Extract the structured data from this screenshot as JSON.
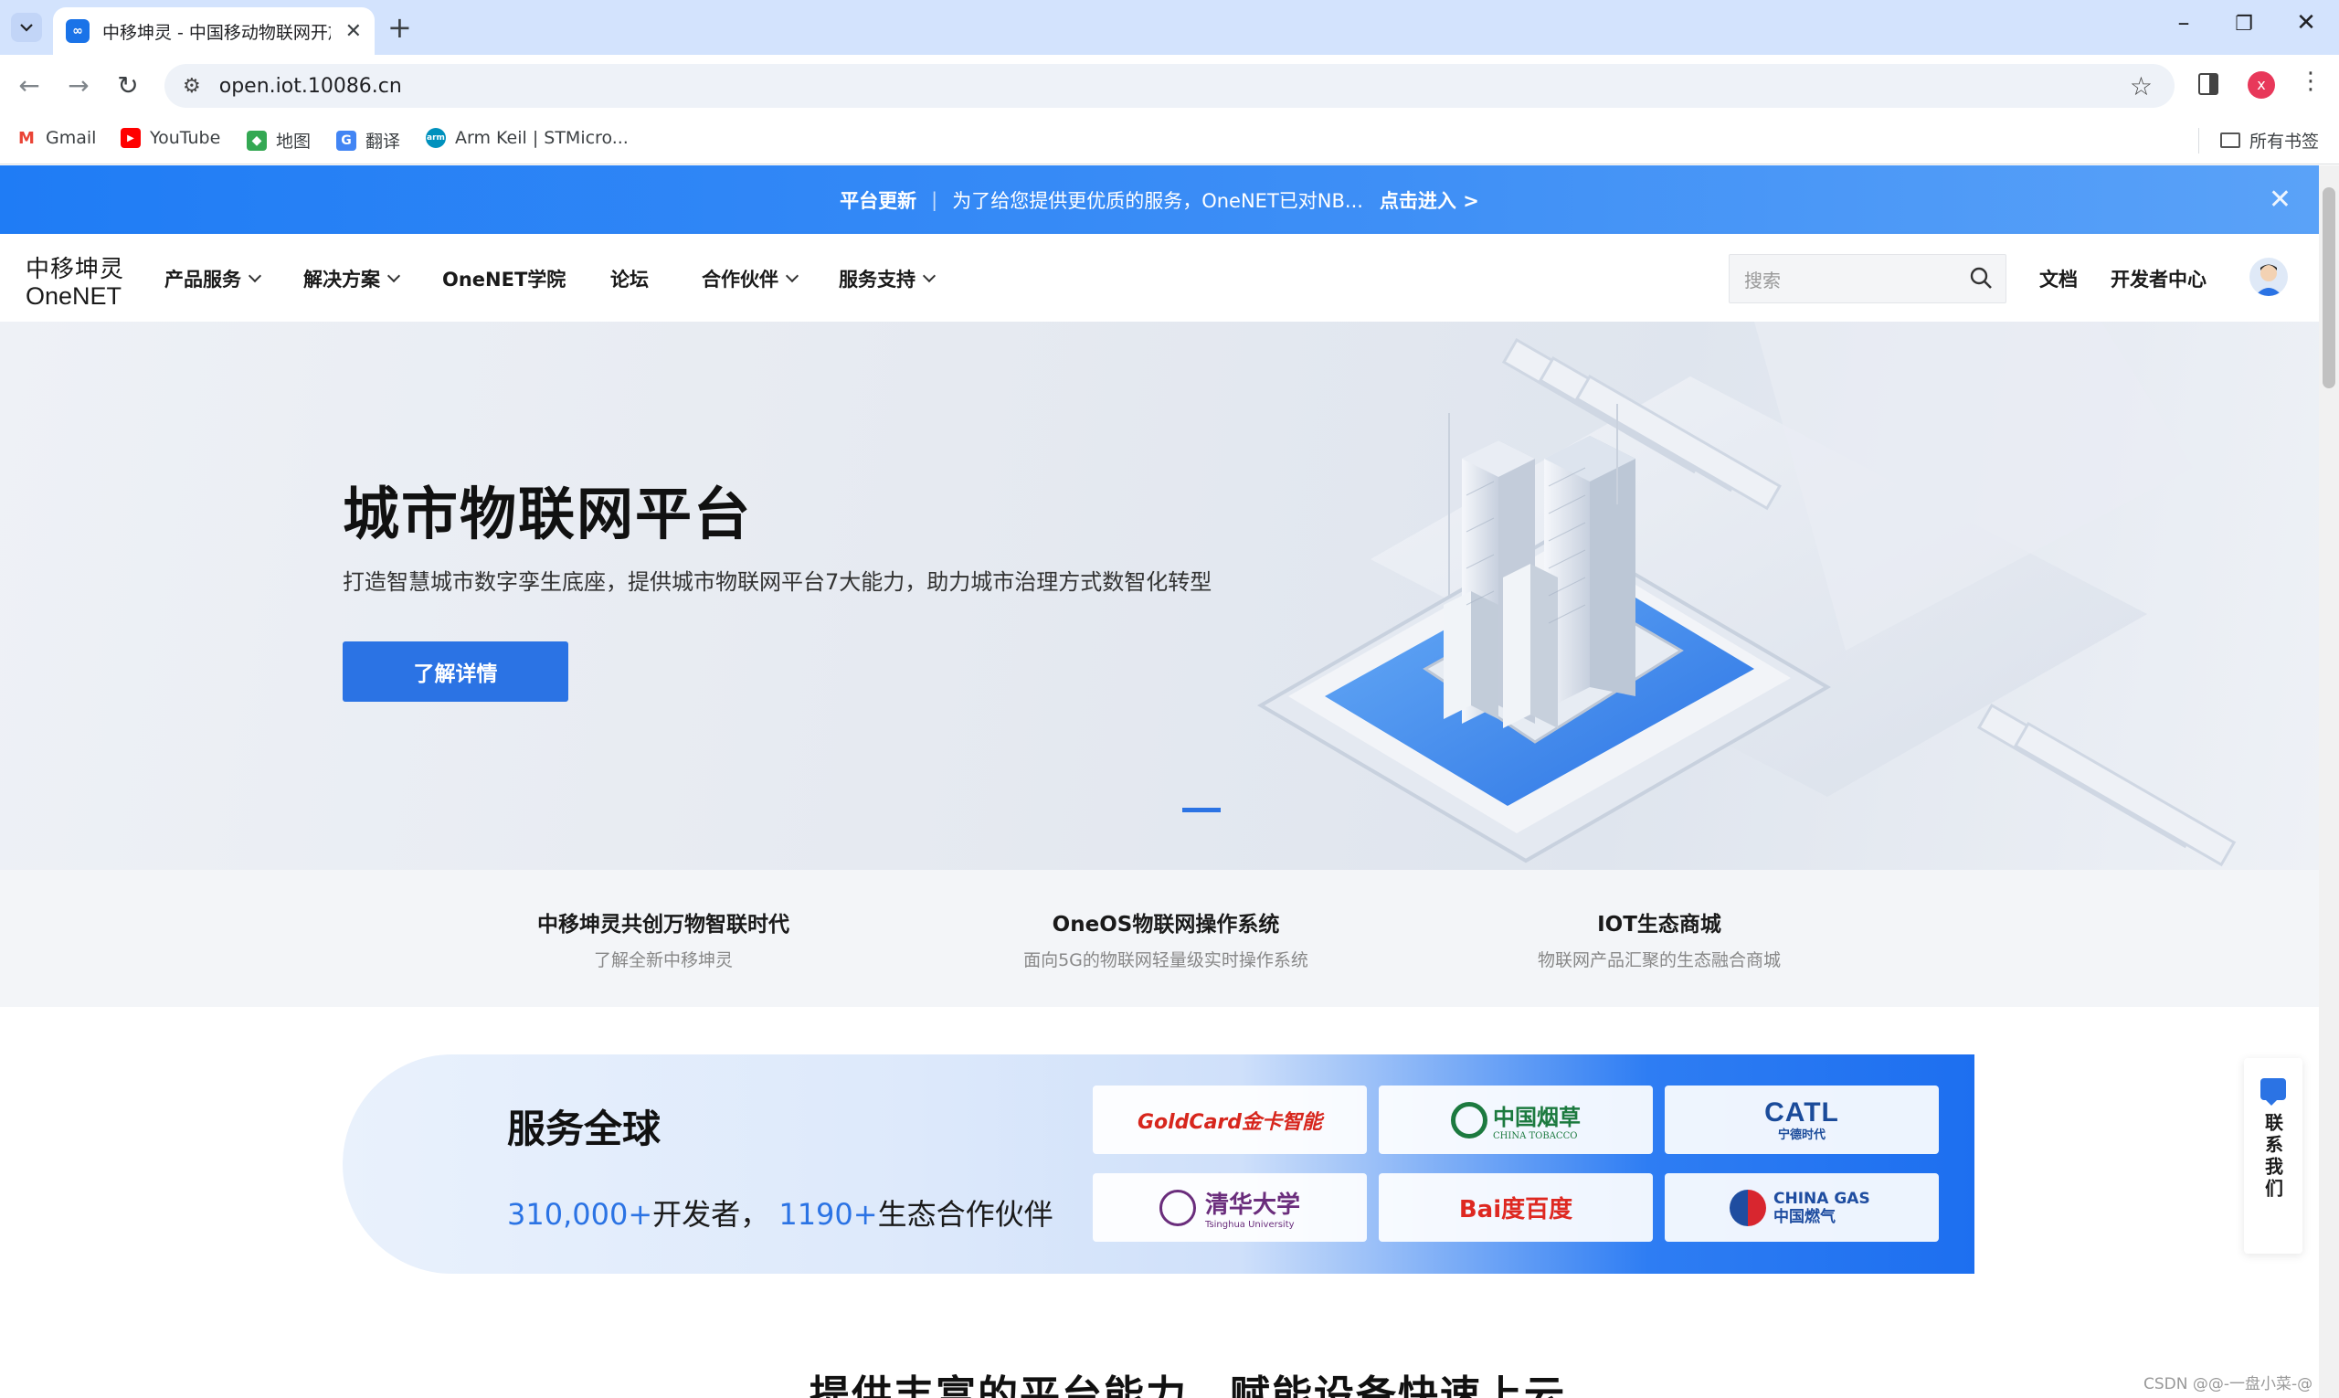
{
  "browser": {
    "tab_title": "中移坤灵 - 中国移动物联网开放",
    "url": "open.iot.10086.cn",
    "bookmarks": [
      "Gmail",
      "YouTube",
      "地图",
      "翻译",
      "Arm Keil | STMicro..."
    ],
    "all_bookmarks": "所有书签",
    "profile_initial": "x"
  },
  "notice": {
    "title": "平台更新",
    "text": "为了给您提供更优质的服务，OneNET已对NB...",
    "link": "点击进入 >"
  },
  "navbar": {
    "logo_cn": "中移坤灵",
    "logo_en": "OneNET",
    "items": [
      "产品服务",
      "解决方案",
      "OneNET学院",
      "论坛",
      "合作伙伴",
      "服务支持"
    ],
    "search_placeholder": "搜索",
    "docs": "文档",
    "dev_center": "开发者中心"
  },
  "hero": {
    "title": "城市物联网平台",
    "subtitle": "打造智慧城市数字孪生底座，提供城市物联网平台7大能力，助力城市治理方式数智化转型",
    "button": "了解详情"
  },
  "features": [
    {
      "title": "中移坤灵共创万物智联时代",
      "subtitle": "了解全新中移坤灵"
    },
    {
      "title": "OneOS物联网操作系统",
      "subtitle": "面向5G的物联网轻量级实时操作系统"
    },
    {
      "title": "IOT生态商城",
      "subtitle": "物联网产品汇聚的生态融合商城"
    }
  ],
  "global": {
    "title": "服务全球",
    "dev_num": "310,000+",
    "dev_label": "开发者，",
    "partner_num": "1190+",
    "partner_label": "生态合作伙伴",
    "partners": [
      "GoldCard金卡智能",
      "中国烟草",
      "CATL",
      "清华大学",
      "Bai度百度",
      "CHINA GAS 中国燃气"
    ],
    "partner_sub": {
      "tobacco": "CHINA TOBACCO",
      "catl": "宁德时代",
      "tsinghua": "Tsinghua University"
    }
  },
  "bottom_title": "提供丰富的平台能力，赋能设备快速上云",
  "contact": "联系我们",
  "watermark": "CSDN @@-一盘小菜-@",
  "colors": {
    "primary": "#2b73e4",
    "notice_bg": "#1f7cf5"
  }
}
